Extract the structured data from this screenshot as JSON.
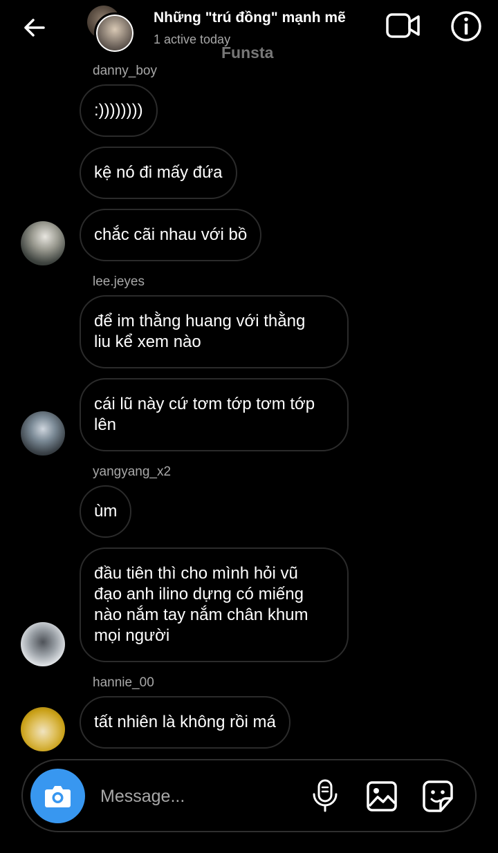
{
  "header": {
    "title": "Những \"trú đồng\" mạnh mẽ",
    "status": "1 active today",
    "watermark": "Funsta"
  },
  "messages": [
    {
      "sender": "danny_boy",
      "text": ":))))))))"
    },
    {
      "text": "kệ nó đi mấy đứa"
    },
    {
      "text": "chắc cãi nhau với bồ"
    },
    {
      "sender": "lee.jeyes",
      "text": "để im thằng huang với thằng\nliu kể xem nào"
    },
    {
      "text": "cái lũ này cứ tơm tớp tơm tớp\nlên"
    },
    {
      "sender": "yangyang_x2",
      "text": "ùm"
    },
    {
      "text": "đầu tiên thì cho mình hỏi vũ\nđạo anh ilino dựng có miếng\nnào nắm tay nắm chân khum\nmọi người"
    },
    {
      "sender": "hannie_00",
      "text": "tất nhiên là không rồi má"
    }
  ],
  "composer": {
    "placeholder": "Message..."
  },
  "colors": {
    "background": "#000000",
    "accent": "#3897f0",
    "bubble_border": "#2b2b2b",
    "secondary_text": "#a8a8a8"
  },
  "icons": [
    "back-arrow-icon",
    "video-call-icon",
    "info-icon",
    "camera-icon",
    "microphone-icon",
    "gallery-icon",
    "sticker-icon"
  ]
}
